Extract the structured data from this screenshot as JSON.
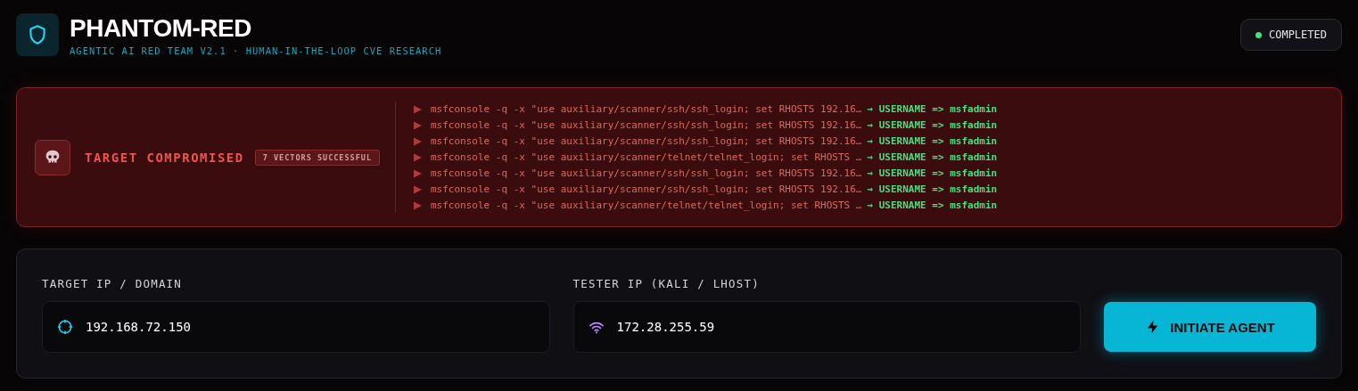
{
  "header": {
    "title": "PHANTOM-RED",
    "subtitle": "AGENTIC AI RED TEAM V2.1 · HUMAN-IN-THE-LOOP CVE RESEARCH",
    "status": "COMPLETED"
  },
  "alert": {
    "title": "TARGET COMPROMISED",
    "badge": "7 VECTORS SUCCESSFUL",
    "log": [
      {
        "command": "msfconsole -q -x \"use auxiliary/scanner/ssh/ssh_login; set RHOSTS 192.16…",
        "result": "→ USERNAME => msfadmin"
      },
      {
        "command": "msfconsole -q -x \"use auxiliary/scanner/ssh/ssh_login; set RHOSTS 192.16…",
        "result": "→ USERNAME => msfadmin"
      },
      {
        "command": "msfconsole -q -x \"use auxiliary/scanner/ssh/ssh_login; set RHOSTS 192.16…",
        "result": "→ USERNAME => msfadmin"
      },
      {
        "command": "msfconsole -q -x \"use auxiliary/scanner/telnet/telnet_login; set RHOSTS …",
        "result": "→ USERNAME => msfadmin"
      },
      {
        "command": "msfconsole -q -x \"use auxiliary/scanner/ssh/ssh_login; set RHOSTS 192.16…",
        "result": "→ USERNAME => msfadmin"
      },
      {
        "command": "msfconsole -q -x \"use auxiliary/scanner/ssh/ssh_login; set RHOSTS 192.16…",
        "result": "→ USERNAME => msfadmin"
      },
      {
        "command": "msfconsole -q -x \"use auxiliary/scanner/telnet/telnet_login; set RHOSTS …",
        "result": "→ USERNAME => msfadmin"
      }
    ]
  },
  "form": {
    "fields": [
      {
        "label": "TARGET IP / DOMAIN",
        "kind": "target",
        "value": "192.168.72.150"
      },
      {
        "label": "TESTER IP (KALI / LHOST)",
        "kind": "wifi",
        "value": "172.28.255.59"
      }
    ],
    "button": "INITIATE AGENT"
  }
}
